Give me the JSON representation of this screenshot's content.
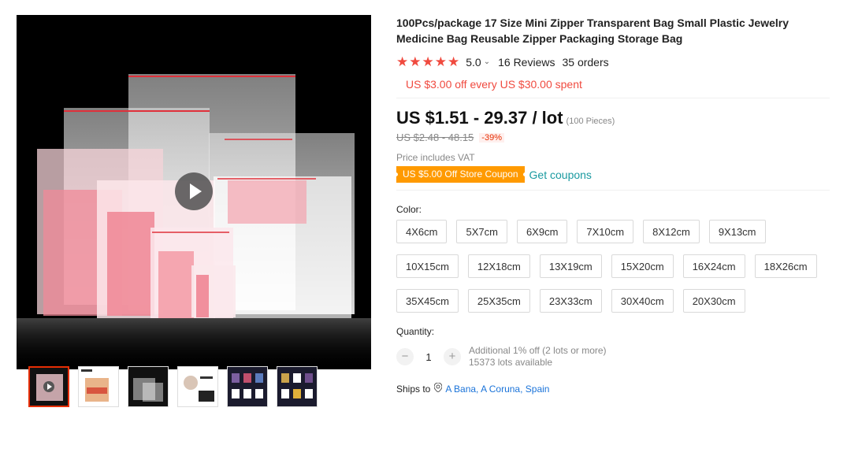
{
  "product": {
    "title": "100Pcs/package 17 Size Mini Zipper Transparent Bag Small Plastic Jewelry Medicine Bag Reusable Zipper Packaging Storage Bag"
  },
  "rating": {
    "stars": 5,
    "score": "5.0",
    "reviews": "16 Reviews",
    "orders": "35 orders",
    "star_color": "#f04a3f"
  },
  "promo": "US $3.00 off every US $30.00 spent",
  "price": {
    "range": "US $1.51 - 29.37 / lot",
    "pieces": "(100 Pieces)",
    "original": "US $2.48 - 48.15",
    "discount": "-39%",
    "vat_note": "Price includes VAT"
  },
  "coupon": {
    "badge": "US $5.00 Off Store Coupon",
    "link": "Get coupons"
  },
  "color": {
    "label": "Color:",
    "options": [
      "4X6cm",
      "5X7cm",
      "6X9cm",
      "7X10cm",
      "8X12cm",
      "9X13cm",
      "10X15cm",
      "12X18cm",
      "13X19cm",
      "15X20cm",
      "16X24cm",
      "18X26cm",
      "35X45cm",
      "25X35cm",
      "23X33cm",
      "30X40cm",
      "20X30cm"
    ]
  },
  "quantity": {
    "label": "Quantity:",
    "minus": "−",
    "value": "1",
    "plus": "+",
    "note1": "Additional 1% off (2 lots or more)",
    "note2": "15373 lots available"
  },
  "shipping": {
    "label": "Ships to",
    "location": "A Bana, A Coruna, Spain"
  },
  "colors": {
    "accent_red": "#f04a3f",
    "coupon_orange": "#ff9a00",
    "link_teal": "#1a9aa0",
    "link_blue": "#1a73d9"
  },
  "gallery": {
    "thumbnails": [
      "thumb-video",
      "thumb-sandwich",
      "thumb-bags-dark",
      "thumb-details",
      "thumb-grid-1",
      "thumb-grid-2"
    ],
    "main_icon": "play-icon",
    "thumb_icon": "play-icon"
  }
}
